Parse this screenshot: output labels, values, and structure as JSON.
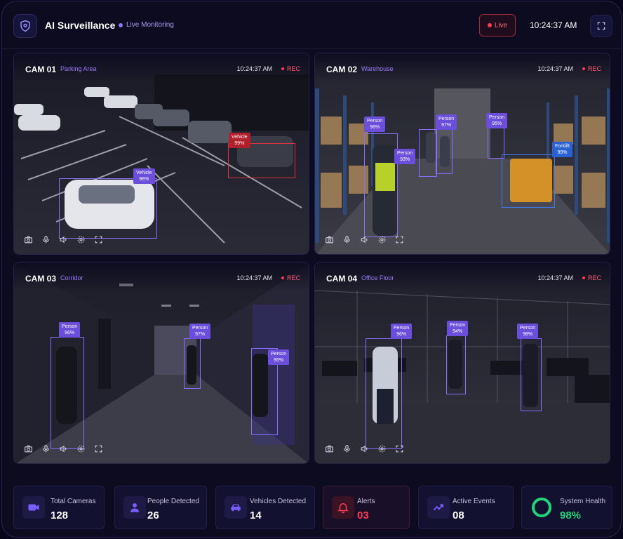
{
  "header": {
    "title": "AI Surveillance",
    "monitoring": "Live Monitoring",
    "live": "Live",
    "time": "10:24:37 AM"
  },
  "cameras": [
    {
      "id": "CAM 01",
      "location": "Parking Area",
      "time": "10:24:37 AM",
      "rec": "REC",
      "detections": [
        {
          "label": "Vehicle",
          "conf": "99%"
        },
        {
          "label": "Vehicle",
          "conf": "98%"
        }
      ]
    },
    {
      "id": "CAM 02",
      "location": "Warehouse",
      "time": "10:24:37 AM",
      "rec": "REC",
      "detections": [
        {
          "label": "Person",
          "conf": "96%"
        },
        {
          "label": "Person",
          "conf": "97%"
        },
        {
          "label": "Person",
          "conf": "95%"
        },
        {
          "label": "Person",
          "conf": "93%"
        },
        {
          "label": "Forklift",
          "conf": "99%"
        }
      ]
    },
    {
      "id": "CAM 03",
      "location": "Corridor",
      "time": "10:24:37 AM",
      "rec": "REC",
      "detections": [
        {
          "label": "Person",
          "conf": "96%"
        },
        {
          "label": "Person",
          "conf": "97%"
        },
        {
          "label": "Person",
          "conf": "95%"
        }
      ]
    },
    {
      "id": "CAM 04",
      "location": "Office Floor",
      "time": "10:24:37 AM",
      "rec": "REC",
      "detections": [
        {
          "label": "Person",
          "conf": "96%"
        },
        {
          "label": "Person",
          "conf": "94%"
        },
        {
          "label": "Person",
          "conf": "98%"
        }
      ]
    }
  ],
  "stats": [
    {
      "label": "Total Cameras",
      "value": "128",
      "icon": "video-camera-icon",
      "color": "#7b5cff"
    },
    {
      "label": "People Detected",
      "value": "26",
      "icon": "person-icon",
      "color": "#7b5cff"
    },
    {
      "label": "Vehicles Detected",
      "value": "14",
      "icon": "car-icon",
      "color": "#7b5cff"
    },
    {
      "label": "Alerts",
      "value": "03",
      "icon": "bell-icon",
      "color": "#ff3b55"
    },
    {
      "label": "Active Events",
      "value": "08",
      "icon": "trend-up-icon",
      "color": "#7b5cff"
    },
    {
      "label": "System Health",
      "value": "98%",
      "icon": "health-ring-icon",
      "color": "#22d37a",
      "level": 0.98
    }
  ],
  "colors": {
    "accent": "#7b5cff",
    "alert": "#ff3b55",
    "health": "#22d37a",
    "background": "#0c0b20"
  }
}
